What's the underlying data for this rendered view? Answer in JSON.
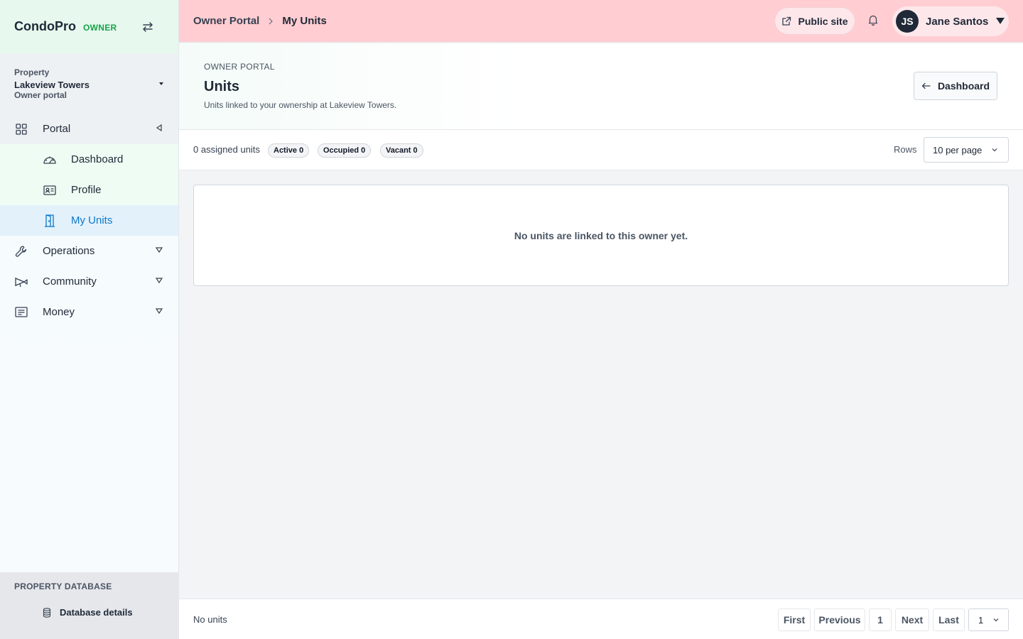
{
  "sidebar": {
    "brand": "CondoPro",
    "role": "OWNER",
    "property": {
      "label": "Property",
      "name": "Lakeview Towers",
      "sub": "Owner portal"
    },
    "groups": [
      {
        "label": "Portal",
        "items": [
          {
            "label": "Dashboard",
            "icon": "speedometer-icon"
          },
          {
            "label": "Profile",
            "icon": "id-card-icon"
          },
          {
            "label": "My Units",
            "icon": "door-icon",
            "active": true
          }
        ]
      },
      {
        "label": "Operations",
        "icon": "wrench-icon"
      },
      {
        "label": "Community",
        "icon": "megaphone-icon"
      },
      {
        "label": "Money",
        "icon": "message-square-icon"
      }
    ],
    "db_section": {
      "title": "PROPERTY DATABASE",
      "item": "Database details"
    }
  },
  "header": {
    "breadcrumb": {
      "parent": "Owner Portal",
      "current": "My Units"
    },
    "public_site": "Public site",
    "user": {
      "initials": "JS",
      "name": "Jane Santos"
    }
  },
  "page": {
    "eyebrow": "OWNER PORTAL",
    "title": "Units",
    "subtitle": "Units linked to your ownership at Lakeview Towers.",
    "back_button": "Dashboard"
  },
  "toolbar": {
    "assigned": "0 assigned units",
    "chips": [
      "Active 0",
      "Occupied 0",
      "Vacant 0"
    ],
    "rows_label": "Rows",
    "rows_value": "10 per page"
  },
  "empty_message": "No units are linked to this owner yet.",
  "footer": {
    "status": "No units",
    "first": "First",
    "previous": "Previous",
    "page": "1",
    "next": "Next",
    "last": "Last",
    "page_select": "1"
  },
  "colors": {
    "header_bg": "#ffcdd2",
    "accent": "#0b78c9",
    "role": "#16a34a"
  }
}
